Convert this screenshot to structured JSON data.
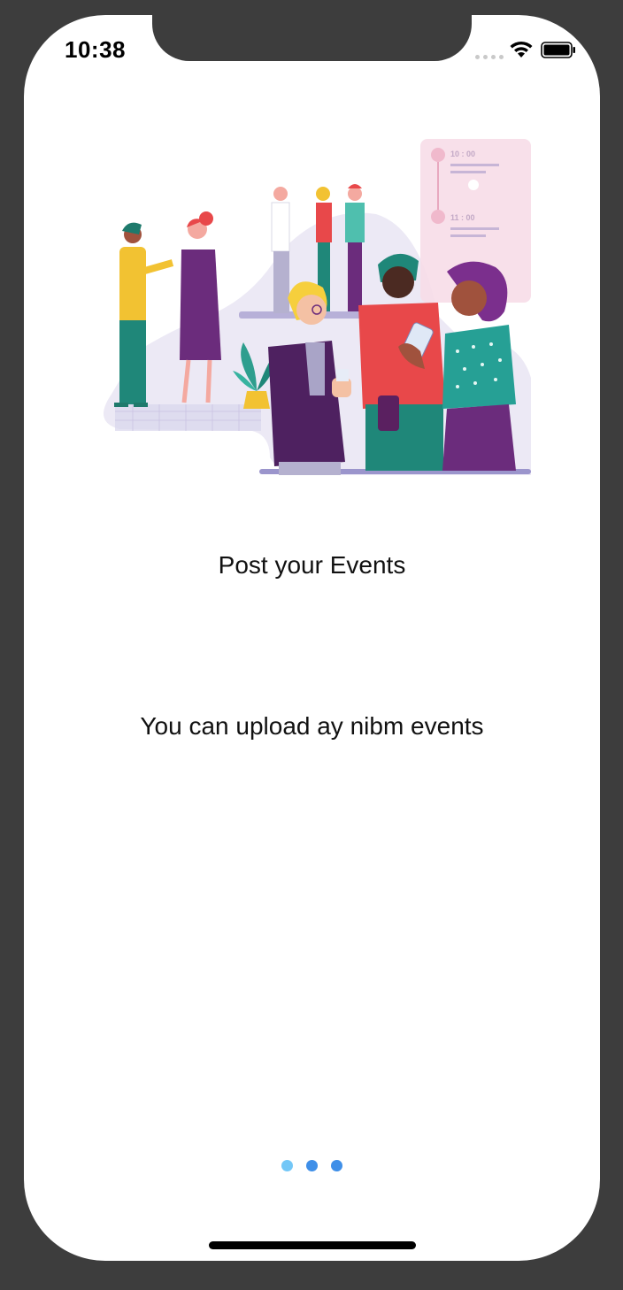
{
  "status_bar": {
    "time": "10:38",
    "icons": [
      "signal-dots-icon",
      "wifi-icon",
      "battery-icon"
    ]
  },
  "onboarding": {
    "illustration": "people-networking-at-event-illustration",
    "schedule_card_times": [
      "10 : 00",
      "11 : 00"
    ],
    "title": "Post your Events",
    "subtitle": "You can upload ay nibm events"
  },
  "page_indicator": {
    "count": 3,
    "current": 1,
    "active_color": "#73c7f7",
    "inactive_color": "#3f8fe8"
  }
}
